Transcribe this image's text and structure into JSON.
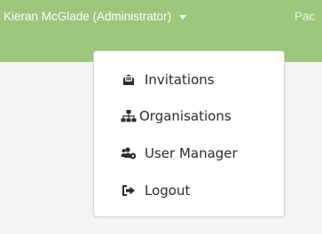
{
  "header": {
    "user_label": "Kieran McGlade (Administrator)",
    "next_nav_label": "Pac"
  },
  "menu": {
    "items": [
      {
        "label": "Invitations",
        "icon": "envelope-open-icon"
      },
      {
        "label": "Organisations",
        "icon": "sitemap-icon"
      },
      {
        "label": "User Manager",
        "icon": "users-cog-icon"
      },
      {
        "label": "Logout",
        "icon": "sign-out-icon"
      }
    ]
  },
  "colors": {
    "header_bg": "#9cc77b",
    "page_bg": "#f4f4f4",
    "menu_text": "#2b2b2b"
  }
}
